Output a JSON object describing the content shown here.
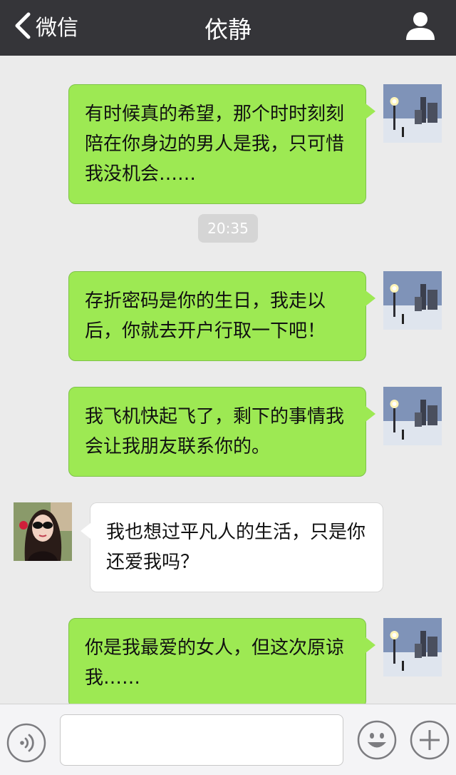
{
  "header": {
    "back_label": "微信",
    "title": "依静",
    "back_icon": "chevron-left-icon",
    "profile_icon": "person-icon"
  },
  "messages": [
    {
      "from": "me",
      "text": "有时候真的希望，那个时时刻刻陪在你身边的男人是我，只可惜我没机会……"
    },
    {
      "type": "time",
      "text": "20:35"
    },
    {
      "from": "me",
      "text": "存折密码是你的生日，我走以后，你就去开户行取一下吧！"
    },
    {
      "from": "me",
      "text": "我飞机快起飞了，剩下的事情我会让我朋友联系你的。"
    },
    {
      "from": "her",
      "text": "我也想过平凡人的生活，只是你还爱我吗？"
    },
    {
      "from": "me",
      "text": "你是我最爱的女人，但这次原谅我……"
    }
  ],
  "input_bar": {
    "text_value": "",
    "voice_icon": "voice-icon",
    "emoji_icon": "emoji-icon",
    "plus_icon": "plus-icon"
  },
  "colors": {
    "header_bg": "#353539",
    "chat_bg": "#ebebeb",
    "sent_bubble": "#9de953",
    "received_bubble": "#ffffff",
    "timestamp_bg": "#d5d5d5"
  }
}
